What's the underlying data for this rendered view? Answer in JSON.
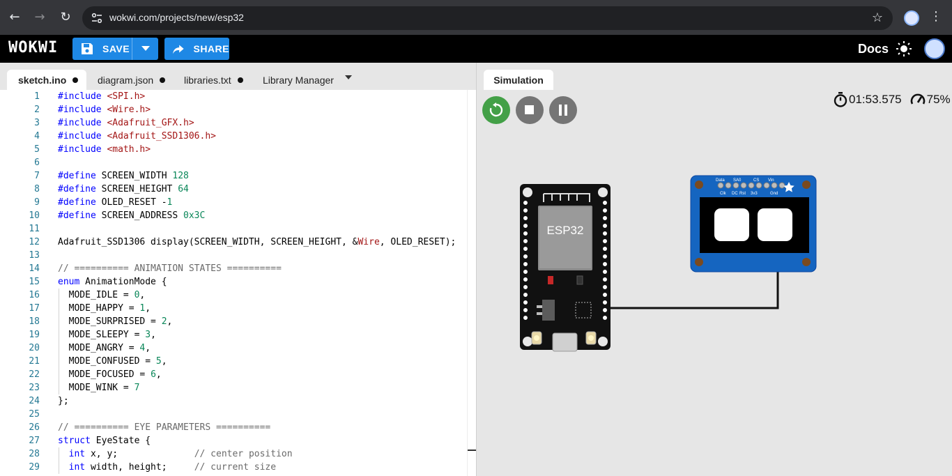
{
  "browser": {
    "url": "wokwi.com/projects/new/esp32",
    "back_icon": "arrow-left-icon",
    "forward_icon": "arrow-right-icon",
    "reload_icon": "reload-icon"
  },
  "header": {
    "logo": "WOKWI",
    "save_label": "SAVE",
    "share_label": "SHARE",
    "docs_label": "Docs",
    "accent": "#1e88e5"
  },
  "editor": {
    "tabs": [
      {
        "label": "sketch.ino",
        "active": true,
        "modified": true
      },
      {
        "label": "diagram.json",
        "active": false,
        "modified": true
      },
      {
        "label": "libraries.txt",
        "active": false,
        "modified": true
      },
      {
        "label": "Library Manager",
        "active": false,
        "modified": false
      }
    ],
    "line_numbers": [
      "1",
      "2",
      "3",
      "4",
      "5",
      "6",
      "7",
      "8",
      "9",
      "10",
      "11",
      "12",
      "13",
      "14",
      "15",
      "16",
      "17",
      "18",
      "19",
      "20",
      "21",
      "22",
      "23",
      "24",
      "25",
      "26",
      "27",
      "28",
      "29"
    ],
    "lines": [
      "#include <SPI.h>",
      "#include <Wire.h>",
      "#include <Adafruit_GFX.h>",
      "#include <Adafruit_SSD1306.h>",
      "#include <math.h>",
      "",
      "#define SCREEN_WIDTH 128",
      "#define SCREEN_HEIGHT 64",
      "#define OLED_RESET -1",
      "#define SCREEN_ADDRESS 0x3C",
      "",
      "Adafruit_SSD1306 display(SCREEN_WIDTH, SCREEN_HEIGHT, &Wire, OLED_RESET);",
      "",
      "// ========== ANIMATION STATES ==========",
      "enum AnimationMode {",
      "  MODE_IDLE = 0,",
      "  MODE_HAPPY = 1,",
      "  MODE_SURPRISED = 2,",
      "  MODE_SLEEPY = 3,",
      "  MODE_ANGRY = 4,",
      "  MODE_CONFUSED = 5,",
      "  MODE_FOCUSED = 6,",
      "  MODE_WINK = 7",
      "};",
      "",
      "// ========== EYE PARAMETERS ==========",
      "struct EyeState {",
      "  int x, y;              // center position",
      "  int width, height;     // current size"
    ]
  },
  "simulation": {
    "tab_label": "Simulation",
    "timer": "01:53.575",
    "speed": "75%",
    "esp32_label": "ESP32",
    "oled_pin_labels_top": [
      "Data",
      "SA0",
      "CS",
      "Vin"
    ],
    "oled_pin_labels_bottom": [
      "Clk",
      "DC",
      "Rst",
      "3v3",
      "Gnd"
    ]
  }
}
